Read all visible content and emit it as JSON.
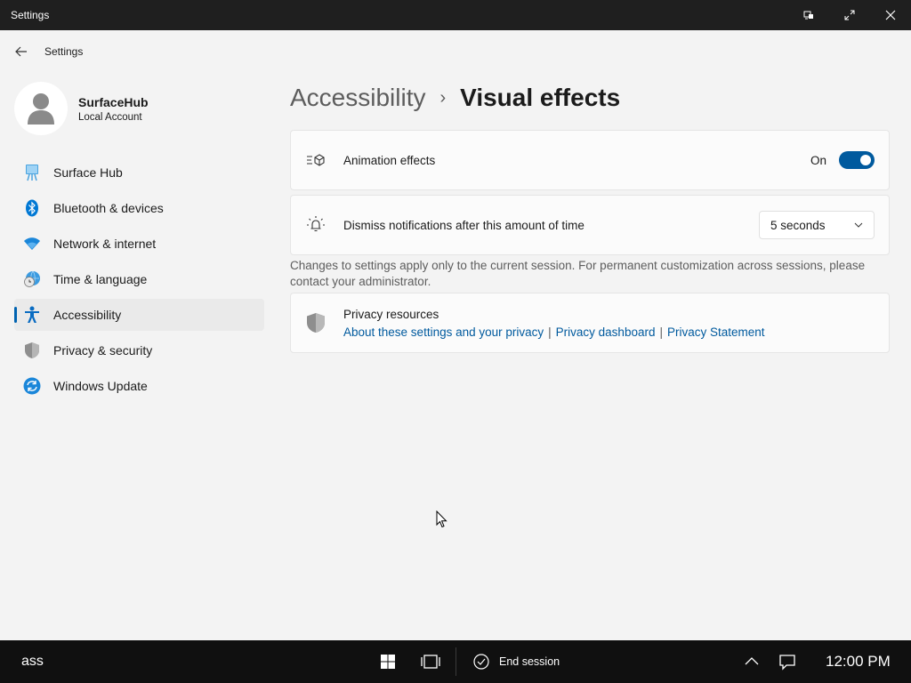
{
  "window": {
    "title": "Settings"
  },
  "header": {
    "app_label": "Settings"
  },
  "profile": {
    "name": "SurfaceHub",
    "account_type": "Local Account"
  },
  "sidebar": {
    "items": [
      {
        "label": "Surface Hub",
        "icon": "surface-hub-icon"
      },
      {
        "label": "Bluetooth & devices",
        "icon": "bluetooth-icon"
      },
      {
        "label": "Network & internet",
        "icon": "wifi-icon"
      },
      {
        "label": "Time & language",
        "icon": "globe-clock-icon"
      },
      {
        "label": "Accessibility",
        "icon": "accessibility-icon",
        "selected": true
      },
      {
        "label": "Privacy & security",
        "icon": "shield-icon"
      },
      {
        "label": "Windows Update",
        "icon": "update-icon"
      }
    ]
  },
  "breadcrumb": {
    "parent": "Accessibility",
    "separator": "›",
    "current": "Visual effects"
  },
  "settings": {
    "animation": {
      "label": "Animation effects",
      "state_label": "On",
      "enabled": true
    },
    "notifications": {
      "label": "Dismiss notifications after this amount of time",
      "selected": "5 seconds"
    },
    "session_note": "Changes to settings apply only to the current session. For permanent customization across sessions, please contact your administrator.",
    "privacy": {
      "title": "Privacy resources",
      "links": [
        "About these settings and your privacy",
        "Privacy dashboard",
        "Privacy Statement"
      ],
      "separator": "|"
    }
  },
  "taskbar": {
    "left_text": "ass",
    "end_session_label": "End session",
    "clock": "12:00 PM"
  },
  "colors": {
    "accent": "#005a9e",
    "titlebar": "#1f1f1f",
    "taskbar": "#101010",
    "background": "#f3f3f3"
  }
}
